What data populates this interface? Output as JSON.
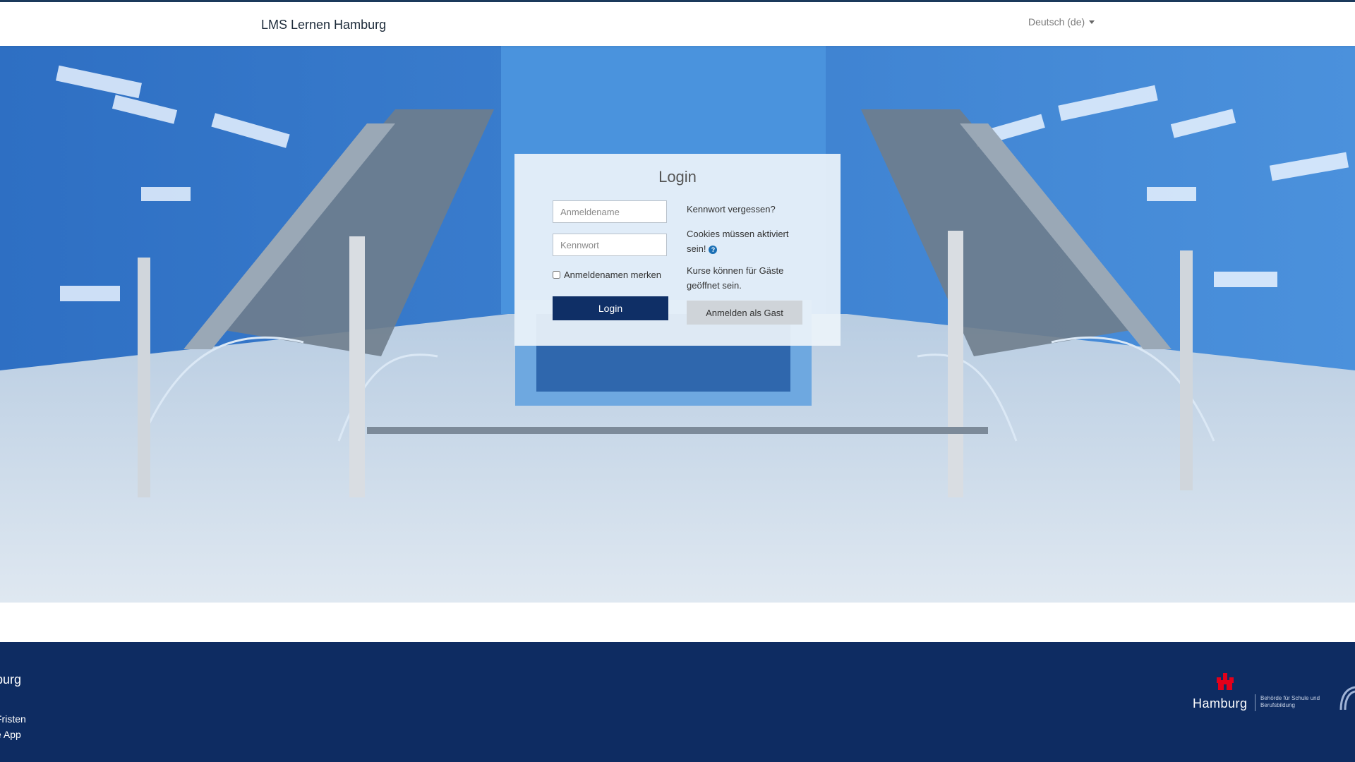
{
  "header": {
    "brand": "LMS Lernen Hamburg",
    "language": "Deutsch (de)"
  },
  "login": {
    "title": "Login",
    "username_placeholder": "Anmeldename",
    "password_placeholder": "Kennwort",
    "remember_label": "Anmeldenamen merken",
    "login_button": "Login",
    "forgot_link": "Kennwort vergessen?",
    "cookies_note": "Cookies müssen aktiviert sein!",
    "guest_note": "Kurse können für Gäste geöffnet sein.",
    "guest_button": "Anmelden als Gast"
  },
  "footer": {
    "title": "burg",
    "links": [
      "Fristen",
      "e App"
    ],
    "logo_text": "Hamburg",
    "dept_text": "Behörde für Schule und Berufsbildung"
  },
  "colors": {
    "primary": "#0f2f66",
    "footer_bg": "#0e2c62",
    "accent": "#1a6fb5"
  },
  "icons": [
    "help-icon",
    "caret-down-icon",
    "hamburg-castle-icon"
  ]
}
